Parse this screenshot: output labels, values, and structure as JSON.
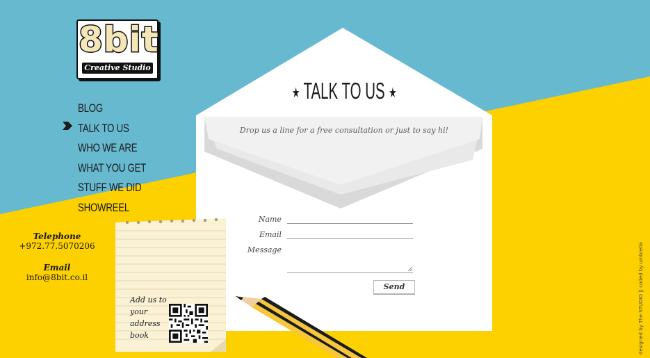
{
  "logo": {
    "big": "8bit",
    "sub": "Creative Studio"
  },
  "nav": {
    "items": [
      {
        "label": "BLOG"
      },
      {
        "label": "TALK TO US"
      },
      {
        "label": "WHO WE ARE"
      },
      {
        "label": "WHAT YOU GET"
      },
      {
        "label": "STUFF WE DID"
      },
      {
        "label": "SHOWREEL"
      }
    ],
    "active_index": 1
  },
  "contact": {
    "title": "TALK TO US",
    "tagline": "Drop us a line for a free consultation or just to say hi!",
    "fields": {
      "name_label": "Name",
      "name_value": "",
      "email_label": "Email",
      "email_value": "",
      "message_label": "Message",
      "message_value": ""
    },
    "send_label": "Send"
  },
  "note": {
    "telephone_label": "Telephone",
    "telephone": "+972.77.5070206",
    "email_label": "Email",
    "email": "info@8bit.co.il",
    "add_us": "Add us to your address book"
  },
  "credit": "designed by The STUDIO || coded by umbrella",
  "colors": {
    "sky": "#66b9cf",
    "ground": "#fdd000",
    "paper": "#ffffff",
    "note": "#fbf2d6"
  },
  "icons": [
    "star-icon",
    "nav-arrow-icon",
    "qr-code",
    "pencil"
  ]
}
